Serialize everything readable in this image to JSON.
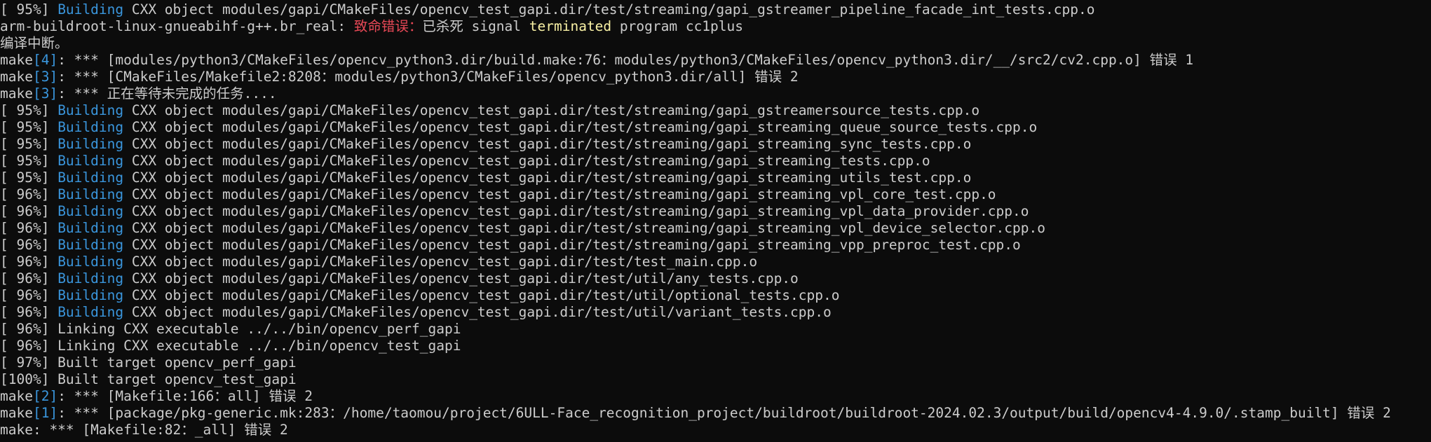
{
  "terminal": {
    "colors": {
      "background": "#0c0c0c",
      "default_text": "#cccccc",
      "building_cyan": "#3a96dd",
      "error_red": "#e74856",
      "terminated_yellow": "#f9f1a5"
    },
    "lines": [
      [
        {
          "t": "[ 95%] ",
          "c": "default"
        },
        {
          "t": "Building",
          "c": "cyan"
        },
        {
          "t": " CXX object modules/gapi/CMakeFiles/opencv_test_gapi.dir/test/streaming/gapi_gstreamer_pipeline_facade_int_tests.cpp.o",
          "c": "default"
        }
      ],
      [
        {
          "t": "arm-buildroot-linux-gnueabihf-g++.br_real: ",
          "c": "default"
        },
        {
          "t": "致命错误：",
          "c": "red"
        },
        {
          "t": "已杀死 signal ",
          "c": "default"
        },
        {
          "t": "terminated",
          "c": "yellow"
        },
        {
          "t": " program cc1plus",
          "c": "default"
        }
      ],
      [
        {
          "t": "编译中断。",
          "c": "default"
        }
      ],
      [
        {
          "t": "make",
          "c": "default"
        },
        {
          "t": "[4]",
          "c": "cyan"
        },
        {
          "t": ": *** [modules/python3/CMakeFiles/opencv_python3.dir/build.make:76：modules/python3/CMakeFiles/opencv_python3.dir/__/src2/cv2.cpp.o] 错误 1",
          "c": "default"
        }
      ],
      [
        {
          "t": "make",
          "c": "default"
        },
        {
          "t": "[3]",
          "c": "cyan"
        },
        {
          "t": ": *** [CMakeFiles/Makefile2:8208：modules/python3/CMakeFiles/opencv_python3.dir/all] 错误 2",
          "c": "default"
        }
      ],
      [
        {
          "t": "make",
          "c": "default"
        },
        {
          "t": "[3]",
          "c": "cyan"
        },
        {
          "t": ": *** 正在等待未完成的任务....",
          "c": "default"
        }
      ],
      [
        {
          "t": "[ 95%] ",
          "c": "default"
        },
        {
          "t": "Building",
          "c": "cyan"
        },
        {
          "t": " CXX object modules/gapi/CMakeFiles/opencv_test_gapi.dir/test/streaming/gapi_gstreamersource_tests.cpp.o",
          "c": "default"
        }
      ],
      [
        {
          "t": "[ 95%] ",
          "c": "default"
        },
        {
          "t": "Building",
          "c": "cyan"
        },
        {
          "t": " CXX object modules/gapi/CMakeFiles/opencv_test_gapi.dir/test/streaming/gapi_streaming_queue_source_tests.cpp.o",
          "c": "default"
        }
      ],
      [
        {
          "t": "[ 95%] ",
          "c": "default"
        },
        {
          "t": "Building",
          "c": "cyan"
        },
        {
          "t": " CXX object modules/gapi/CMakeFiles/opencv_test_gapi.dir/test/streaming/gapi_streaming_sync_tests.cpp.o",
          "c": "default"
        }
      ],
      [
        {
          "t": "[ 95%] ",
          "c": "default"
        },
        {
          "t": "Building",
          "c": "cyan"
        },
        {
          "t": " CXX object modules/gapi/CMakeFiles/opencv_test_gapi.dir/test/streaming/gapi_streaming_tests.cpp.o",
          "c": "default"
        }
      ],
      [
        {
          "t": "[ 95%] ",
          "c": "default"
        },
        {
          "t": "Building",
          "c": "cyan"
        },
        {
          "t": " CXX object modules/gapi/CMakeFiles/opencv_test_gapi.dir/test/streaming/gapi_streaming_utils_test.cpp.o",
          "c": "default"
        }
      ],
      [
        {
          "t": "[ 96%] ",
          "c": "default"
        },
        {
          "t": "Building",
          "c": "cyan"
        },
        {
          "t": " CXX object modules/gapi/CMakeFiles/opencv_test_gapi.dir/test/streaming/gapi_streaming_vpl_core_test.cpp.o",
          "c": "default"
        }
      ],
      [
        {
          "t": "[ 96%] ",
          "c": "default"
        },
        {
          "t": "Building",
          "c": "cyan"
        },
        {
          "t": " CXX object modules/gapi/CMakeFiles/opencv_test_gapi.dir/test/streaming/gapi_streaming_vpl_data_provider.cpp.o",
          "c": "default"
        }
      ],
      [
        {
          "t": "[ 96%] ",
          "c": "default"
        },
        {
          "t": "Building",
          "c": "cyan"
        },
        {
          "t": " CXX object modules/gapi/CMakeFiles/opencv_test_gapi.dir/test/streaming/gapi_streaming_vpl_device_selector.cpp.o",
          "c": "default"
        }
      ],
      [
        {
          "t": "[ 96%] ",
          "c": "default"
        },
        {
          "t": "Building",
          "c": "cyan"
        },
        {
          "t": " CXX object modules/gapi/CMakeFiles/opencv_test_gapi.dir/test/streaming/gapi_streaming_vpp_preproc_test.cpp.o",
          "c": "default"
        }
      ],
      [
        {
          "t": "[ 96%] ",
          "c": "default"
        },
        {
          "t": "Building",
          "c": "cyan"
        },
        {
          "t": " CXX object modules/gapi/CMakeFiles/opencv_test_gapi.dir/test/test_main.cpp.o",
          "c": "default"
        }
      ],
      [
        {
          "t": "[ 96%] ",
          "c": "default"
        },
        {
          "t": "Building",
          "c": "cyan"
        },
        {
          "t": " CXX object modules/gapi/CMakeFiles/opencv_test_gapi.dir/test/util/any_tests.cpp.o",
          "c": "default"
        }
      ],
      [
        {
          "t": "[ 96%] ",
          "c": "default"
        },
        {
          "t": "Building",
          "c": "cyan"
        },
        {
          "t": " CXX object modules/gapi/CMakeFiles/opencv_test_gapi.dir/test/util/optional_tests.cpp.o",
          "c": "default"
        }
      ],
      [
        {
          "t": "[ 96%] ",
          "c": "default"
        },
        {
          "t": "Building",
          "c": "cyan"
        },
        {
          "t": " CXX object modules/gapi/CMakeFiles/opencv_test_gapi.dir/test/util/variant_tests.cpp.o",
          "c": "default"
        }
      ],
      [
        {
          "t": "[ 96%] Linking CXX executable ../../bin/opencv_perf_gapi",
          "c": "default"
        }
      ],
      [
        {
          "t": "[ 96%] Linking CXX executable ../../bin/opencv_test_gapi",
          "c": "default"
        }
      ],
      [
        {
          "t": "[ 97%] Built target opencv_perf_gapi",
          "c": "default"
        }
      ],
      [
        {
          "t": "[100%] Built target opencv_test_gapi",
          "c": "default"
        }
      ],
      [
        {
          "t": "make",
          "c": "default"
        },
        {
          "t": "[2]",
          "c": "cyan"
        },
        {
          "t": ": *** [Makefile:166：all] 错误 2",
          "c": "default"
        }
      ],
      [
        {
          "t": "make",
          "c": "default"
        },
        {
          "t": "[1]",
          "c": "cyan"
        },
        {
          "t": ": *** [package/pkg-generic.mk:283：/home/taomou/project/6ULL-Face_recognition_project/buildroot/buildroot-2024.02.3/output/build/opencv4-4.9.0/.stamp_built] 错误 2",
          "c": "default"
        }
      ],
      [
        {
          "t": "make: *** [Makefile:82：_all] 错误 2",
          "c": "default"
        }
      ]
    ]
  }
}
